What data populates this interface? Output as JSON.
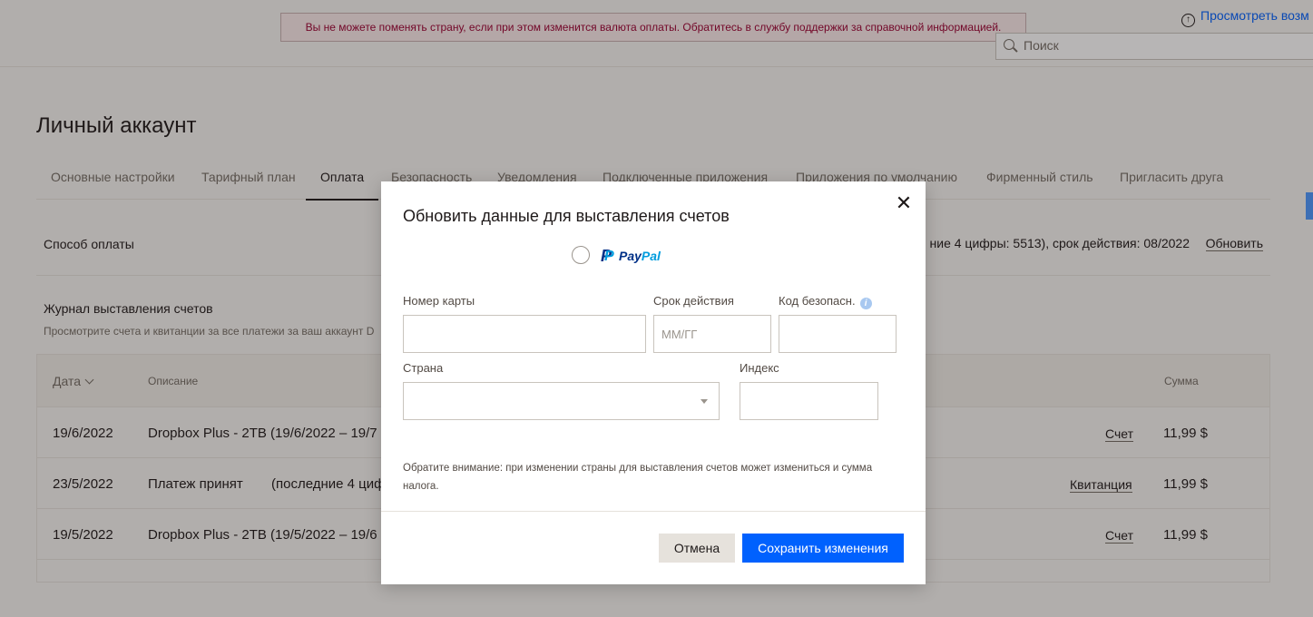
{
  "alert": {
    "text": "Вы не можете поменять страну, если при этом изменится валюта оплаты. Обратитесь в службу поддержки за справочной информацией."
  },
  "header": {
    "upgrade_link": "Просмотреть возм",
    "search_placeholder": "Поиск"
  },
  "page": {
    "title": "Личный аккаунт",
    "tabs": [
      {
        "label": "Основные настройки"
      },
      {
        "label": "Тарифный план"
      },
      {
        "label": "Оплата"
      },
      {
        "label": "Безопасность"
      },
      {
        "label": "Уведомления"
      },
      {
        "label": "Подключенные приложения"
      },
      {
        "label": "Приложения по умолчанию"
      },
      {
        "label": "Фирменный стиль"
      },
      {
        "label": "Пригласить друга"
      }
    ],
    "active_tab": "Оплата"
  },
  "payment": {
    "label": "Способ оплаты",
    "info": "ние 4 цифры: 5513), срок действия: 08/2022",
    "update": "Обновить"
  },
  "journal": {
    "title": "Журнал выставления счетов",
    "description": "Просмотрите счета и квитанции за все платежи за ваш аккаунт D",
    "columns": {
      "date": "Дата",
      "description": "Описание",
      "amount": "Сумма"
    },
    "rows": [
      {
        "date": "19/6/2022",
        "description": "Dropbox Plus - 2TB (19/6/2022 – 19/7",
        "link": "Счет",
        "amount": "11,99 $"
      },
      {
        "date": "23/5/2022",
        "description": "Платеж принят",
        "description_extra": "(последние 4 циф",
        "link": "Квитанция",
        "amount": "11,99 $"
      },
      {
        "date": "19/5/2022",
        "description": "Dropbox Plus - 2TB (19/5/2022 – 19/6",
        "link": "Счет",
        "amount": "11,99 $"
      }
    ]
  },
  "modal": {
    "title": "Обновить данные для выставления счетов",
    "paypal": {
      "part1": "Pay",
      "part2": "Pal"
    },
    "card_number_label": "Номер карты",
    "card_number_value": "",
    "expiry_label": "Срок действия",
    "expiry_placeholder": "ММ/ГГ",
    "cvv_label": "Код безопасн.",
    "cvv_value": "",
    "country_label": "Страна",
    "country_value": "",
    "zip_label": "Индекс",
    "zip_value": "",
    "note": "Обратите внимание: при изменении страны для выставления счетов может измениться и сумма налога.",
    "cancel": "Отмена",
    "save": "Сохранить изменения"
  },
  "colors": {
    "accent": "#0061fe",
    "alert_text": "#9b0032",
    "alert_border": "#c8b0b0",
    "paypal_dark": "#003087",
    "paypal_light": "#009cde"
  }
}
